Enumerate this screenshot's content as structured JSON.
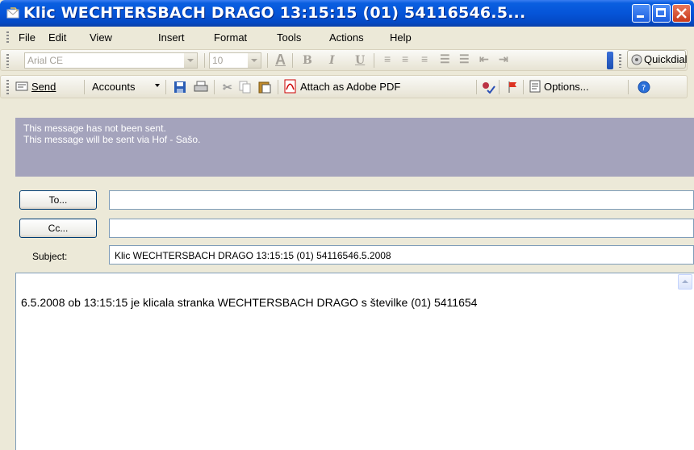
{
  "window": {
    "title": "Klic WECHTERSBACH DRAGO 13:15:15 (01) 54116546.5..."
  },
  "menu": [
    "File",
    "Edit",
    "View",
    "Insert",
    "Format",
    "Tools",
    "Actions",
    "Help"
  ],
  "format_toolbar": {
    "font_name": "Arial CE",
    "font_size": "10",
    "quickdial_label": "Quickdial"
  },
  "main_toolbar": {
    "send_label": "Send",
    "accounts_label": "Accounts",
    "attach_pdf_label": "Attach as Adobe PDF",
    "options_label": "Options..."
  },
  "info": {
    "line1": "This message has not been sent.",
    "line2": "This message will be sent via Hof - Sašo."
  },
  "header": {
    "to_label": "To...",
    "cc_label": "Cc...",
    "to_value": "",
    "cc_value": "",
    "subject_label": "Subject:",
    "subject_value": "Klic WECHTERSBACH DRAGO 13:15:15 (01) 54116546.5.2008"
  },
  "message": {
    "body": "6.5.2008  ob 13:15:15 je klicala stranka WECHTERSBACH DRAGO s številke (01) 5411654"
  },
  "colors": {
    "titlebar": "#0554d8",
    "info_bar": "#a4a3bc",
    "chrome": "#ece9d8"
  }
}
